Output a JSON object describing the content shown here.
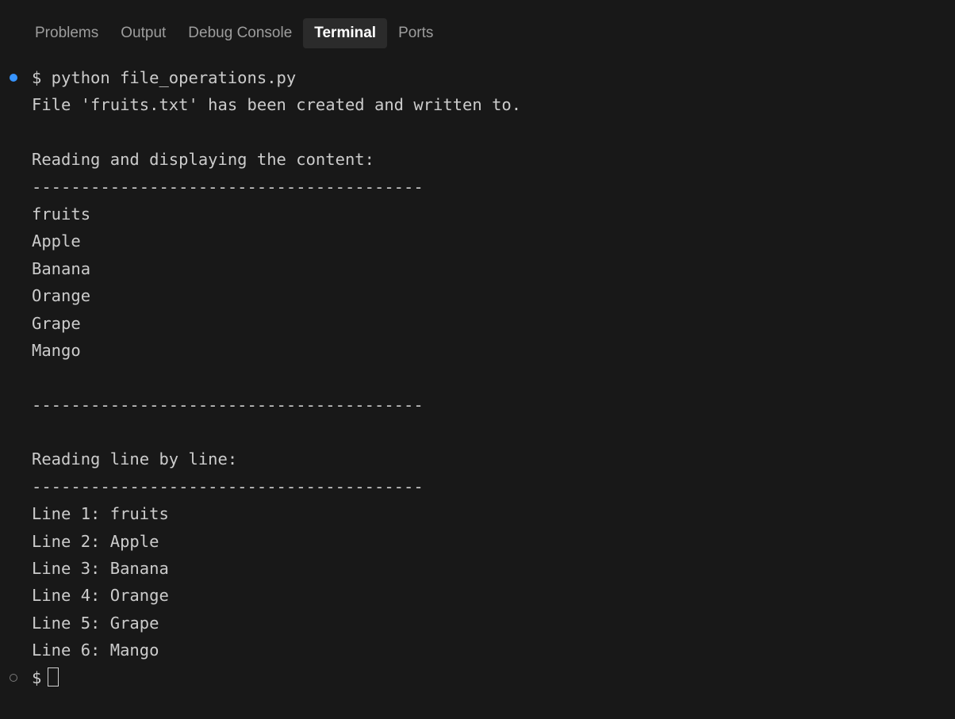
{
  "tabs": [
    {
      "label": "Problems",
      "active": false
    },
    {
      "label": "Output",
      "active": false
    },
    {
      "label": "Debug Console",
      "active": false
    },
    {
      "label": "Terminal",
      "active": true
    },
    {
      "label": "Ports",
      "active": false
    }
  ],
  "terminal": {
    "prompt_symbol": "$",
    "colors": {
      "background": "#181818",
      "text": "#cccccc",
      "success_decoration": "#3794ff"
    },
    "lines": [
      {
        "text": "$ python file_operations.py",
        "decoration": "success"
      },
      {
        "text": "File 'fruits.txt' has been created and written to."
      },
      {
        "text": ""
      },
      {
        "text": "Reading and displaying the content:"
      },
      {
        "text": "----------------------------------------"
      },
      {
        "text": "fruits"
      },
      {
        "text": "Apple"
      },
      {
        "text": "Banana"
      },
      {
        "text": "Orange"
      },
      {
        "text": "Grape"
      },
      {
        "text": "Mango"
      },
      {
        "text": ""
      },
      {
        "text": "----------------------------------------"
      },
      {
        "text": ""
      },
      {
        "text": "Reading line by line:"
      },
      {
        "text": "----------------------------------------"
      },
      {
        "text": "Line 1: fruits"
      },
      {
        "text": "Line 2: Apple"
      },
      {
        "text": "Line 3: Banana"
      },
      {
        "text": "Line 4: Orange"
      },
      {
        "text": "Line 5: Grape"
      },
      {
        "text": "Line 6: Mango"
      }
    ]
  }
}
